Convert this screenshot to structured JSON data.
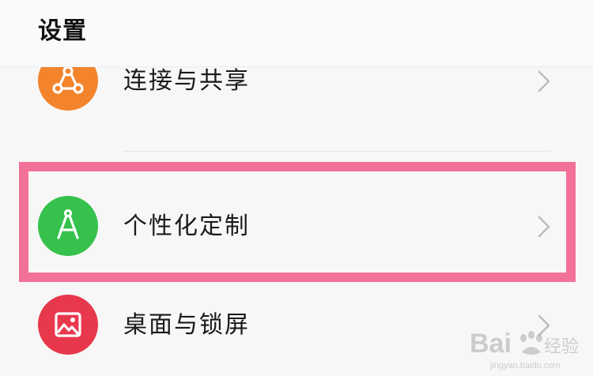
{
  "header": {
    "title": "设置"
  },
  "settings_items": [
    {
      "label": "连接与共享",
      "icon": "share-connect-icon",
      "icon_color": "#f4842c"
    },
    {
      "label": "个性化定制",
      "icon": "compass-icon",
      "icon_color": "#35c14c"
    },
    {
      "label": "桌面与锁屏",
      "icon": "picture-icon",
      "icon_color": "#e8384c"
    }
  ],
  "highlight": {
    "color": "#f27199",
    "target": "个性化定制"
  },
  "watermark": {
    "text": "Baidu经验",
    "subtext": "jingyan.baidu.com"
  }
}
